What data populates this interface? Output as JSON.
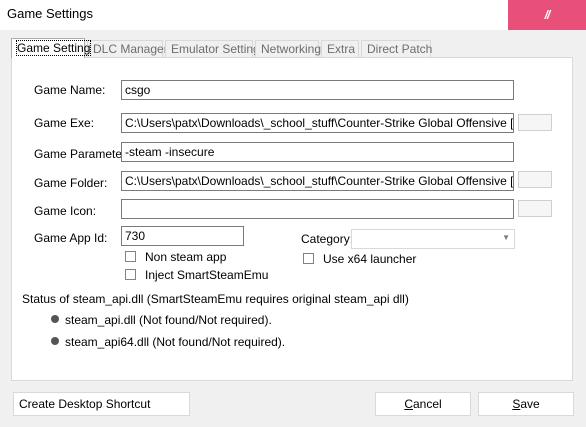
{
  "window": {
    "title": "Game Settings",
    "close_glyph": "//",
    "accent_color": "#e8507a"
  },
  "tabs": [
    {
      "label": "Game Setting",
      "active": true
    },
    {
      "label": "DLC Manager",
      "active": false
    },
    {
      "label": "Emulator Setting",
      "active": false
    },
    {
      "label": "Networking",
      "active": false
    },
    {
      "label": "Extra",
      "active": false
    },
    {
      "label": "Direct Patch",
      "active": false
    }
  ],
  "form": {
    "game_name_label": "Game Name:",
    "game_name_value": "csgo",
    "game_exe_label": "Game Exe:",
    "game_exe_value": "C:\\Users\\patx\\Downloads\\_school_stuff\\Counter-Strike Global Offensive [BuildID",
    "game_parameter_label": "Game Parameter:",
    "game_parameter_value": "-steam -insecure",
    "game_folder_label": "Game Folder:",
    "game_folder_value": "C:\\Users\\patx\\Downloads\\_school_stuff\\Counter-Strike Global Offensive [BuildID",
    "game_icon_label": "Game Icon:",
    "game_icon_value": "",
    "app_id_label": "Game App Id:",
    "app_id_value": "730",
    "non_steam_label": "Non steam app",
    "inject_label": "Inject SmartSteamEmu",
    "category_label": "Category:",
    "category_value": "",
    "x64_label": "Use x64 launcher"
  },
  "status": {
    "heading": "Status of steam_api.dll (SmartSteamEmu requires original steam_api dll)",
    "items": [
      "steam_api.dll (Not found/Not required).",
      "steam_api64.dll (Not found/Not required)."
    ]
  },
  "buttons": {
    "shortcut": "Create Desktop Shortcut",
    "cancel_first": "C",
    "cancel_rest": "ancel",
    "save_first": "S",
    "save_rest": "ave"
  }
}
